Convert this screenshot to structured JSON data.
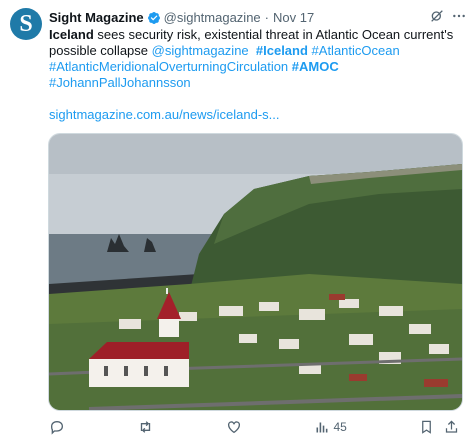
{
  "tweet": {
    "avatar_letter": "S",
    "author_name": "Sight Magazine",
    "handle": "@sightmagazine",
    "separator": "·",
    "date": "Nov 17",
    "text": {
      "bold_word": "Iceland",
      "line1_rest": " sees security risk, existential threat in Atlantic Ocean current's",
      "line2_plain": "possible collapse ",
      "mention": "@sightmagazine",
      "tag_iceland": "#Iceland",
      "tag_atlantic": "#AtlanticOcean",
      "tag_amoc_long": "#AtlanticMeridionalOverturningCirculation",
      "tag_amoc": "#AMOC",
      "tag_person": "#JohannPallJohannsson"
    },
    "url": "sightmagazine.com.au/news/iceland-s...",
    "views_count": "45"
  },
  "colors": {
    "accent": "#1d9bf0",
    "muted": "#536471",
    "avatar_bg": "#1f7aa8"
  },
  "icons": [
    "verified-badge-icon",
    "grok-icon",
    "more-icon",
    "reply-icon",
    "retweet-icon",
    "like-icon",
    "views-icon",
    "bookmark-icon",
    "share-icon"
  ]
}
